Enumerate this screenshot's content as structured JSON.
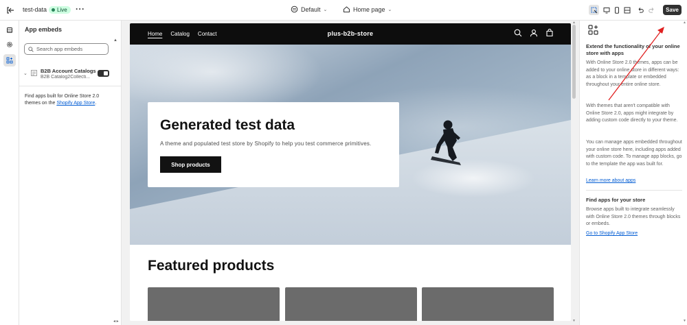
{
  "topbar": {
    "store_name": "test-data",
    "status_badge": "Live",
    "theme_label": "Default",
    "page_label": "Home page",
    "save_label": "Save"
  },
  "left_panel": {
    "title": "App embeds",
    "search_placeholder": "Search app embeds",
    "embed": {
      "name": "B2B Account Catalogs",
      "subtitle": "B2B Catalog2Collecti...",
      "enabled": true
    },
    "footer_text": "Find apps built for Online Store 2.0 themes on the",
    "footer_link": "Shopify App Store",
    "footer_end": "."
  },
  "storefront": {
    "nav": [
      "Home",
      "Catalog",
      "Contact"
    ],
    "logo": "plus-b2b-store",
    "hero_title": "Generated test data",
    "hero_subtitle": "A theme and populated test store by Shopify to help you test commerce primitives.",
    "hero_button": "Shop products",
    "featured_title": "Featured products"
  },
  "right_panel": {
    "heading": "Extend the functionality of your online store with apps",
    "para1": "With Online Store 2.0 themes, apps can be added to your online store in different ways: as a block in a template or embedded throughout your entire online store.",
    "para2": "With themes that aren't compatible with Online Store 2.0, apps might integrate by adding custom code directly to your theme.",
    "para3": "You can manage apps embedded throughout your online store here, including apps added with custom code. To manage app blocks, go to the template the app was built for.",
    "learn_link": "Learn more about apps",
    "heading2": "Find apps for your store",
    "para4": "Browse apps built to integrate seamlessly with Online Store 2.0 themes through blocks or embeds.",
    "store_link": "Go to Shopify App Store"
  },
  "colors": {
    "accent": "#005bd3",
    "annotation_arrow": "#e02020",
    "live_badge_bg": "#cdfee1",
    "header_bg": "#0d0d0d"
  }
}
